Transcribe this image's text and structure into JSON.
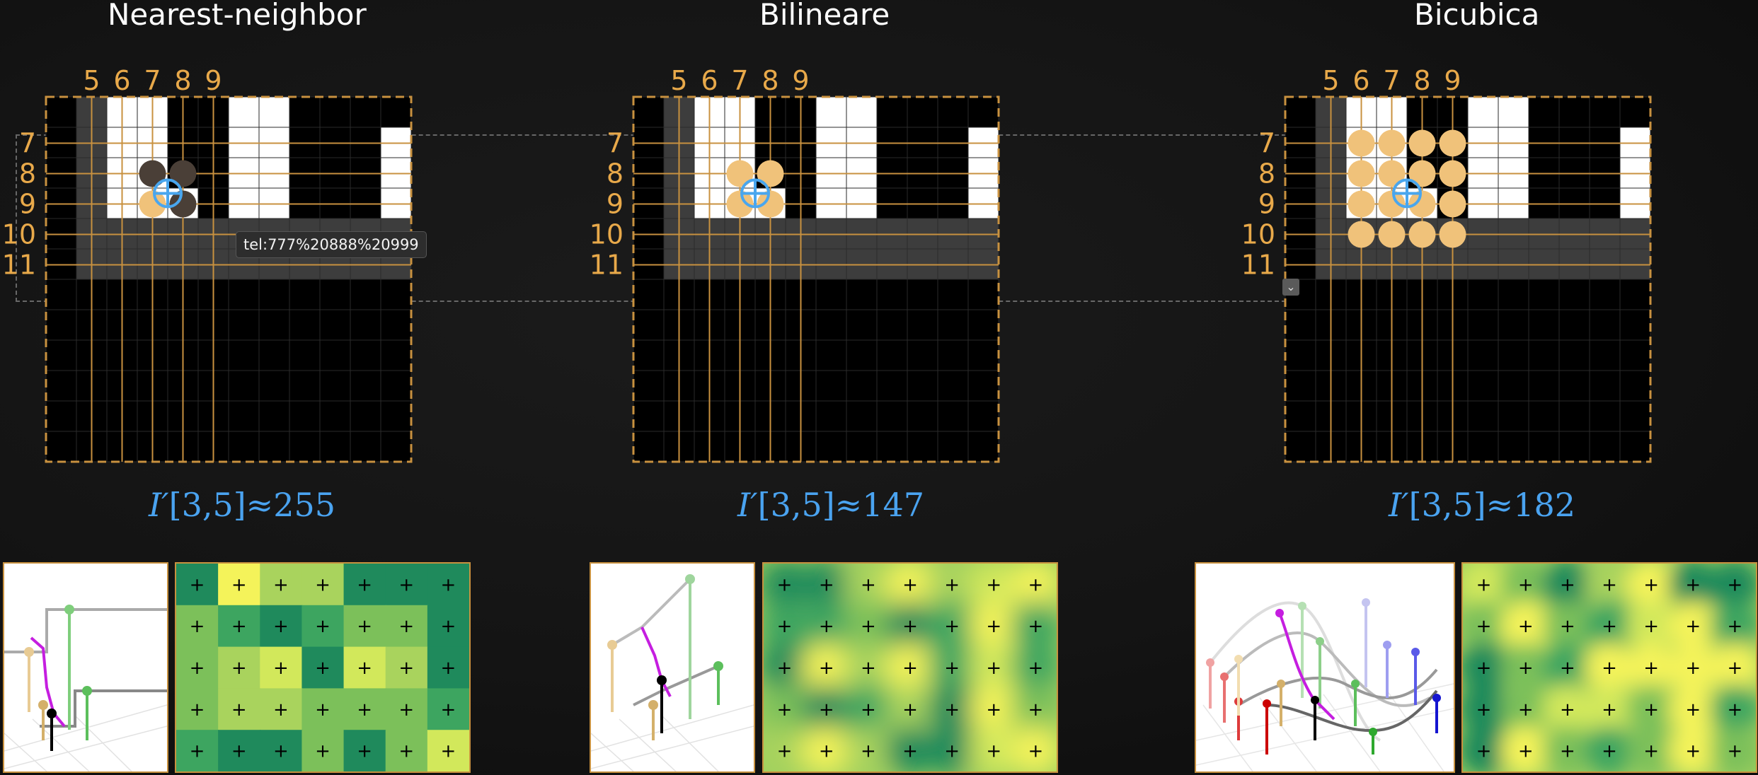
{
  "panels": [
    {
      "key": "nearest",
      "title": "Nearest-neighbor",
      "formula_prefix": "I′",
      "formula_rest": "[3,5]≈255",
      "col_labels": [
        "5",
        "6",
        "7",
        "8",
        "9"
      ],
      "row_labels": [
        "7",
        "8",
        "9",
        "10",
        "11"
      ],
      "sample_dots": [
        [
          7,
          8,
          "dark"
        ],
        [
          8,
          8,
          "dark"
        ],
        [
          7,
          9,
          "light"
        ],
        [
          8,
          9,
          "dark"
        ]
      ]
    },
    {
      "key": "bilinear",
      "title": "Bilineare",
      "formula_prefix": "I′",
      "formula_rest": "[3,5]≈147",
      "col_labels": [
        "5",
        "6",
        "7",
        "8",
        "9"
      ],
      "row_labels": [
        "7",
        "8",
        "9",
        "10",
        "11"
      ],
      "sample_dots": [
        [
          7,
          8,
          "light"
        ],
        [
          8,
          8,
          "light"
        ],
        [
          7,
          9,
          "light"
        ],
        [
          8,
          9,
          "light"
        ]
      ]
    },
    {
      "key": "bicubic",
      "title": "Bicubica",
      "formula_prefix": "I′",
      "formula_rest": "[3,5]≈182",
      "col_labels": [
        "5",
        "6",
        "7",
        "8",
        "9"
      ],
      "row_labels": [
        "7",
        "8",
        "9",
        "10",
        "11"
      ],
      "sample_dots": [
        [
          6,
          7,
          "light"
        ],
        [
          7,
          7,
          "light"
        ],
        [
          8,
          7,
          "light"
        ],
        [
          9,
          7,
          "light"
        ],
        [
          6,
          8,
          "light"
        ],
        [
          7,
          8,
          "light"
        ],
        [
          8,
          8,
          "light"
        ],
        [
          9,
          8,
          "light"
        ],
        [
          6,
          9,
          "light"
        ],
        [
          7,
          9,
          "light"
        ],
        [
          8,
          9,
          "light"
        ],
        [
          9,
          9,
          "light"
        ],
        [
          6,
          10,
          "light"
        ],
        [
          7,
          10,
          "light"
        ],
        [
          8,
          10,
          "light"
        ],
        [
          9,
          10,
          "light"
        ]
      ]
    }
  ],
  "tooltip": {
    "text": "tel:777%20888%20999"
  },
  "colors": {
    "grid_line": "#c8913f",
    "frame": "#c8913f",
    "dot_light": "#f0c27a",
    "dot_dark": "#4a3f37",
    "crosshair": "#49a6ee",
    "formula": "#4aa3f0",
    "label": "#e8a94a",
    "gray_pixel": "#3d3d3d",
    "white_pixel": "#ffffff",
    "black_pixel": "#000000"
  },
  "icons": {
    "crosshair": "circle-plus-icon",
    "dropdown": "chevron-down-icon"
  }
}
